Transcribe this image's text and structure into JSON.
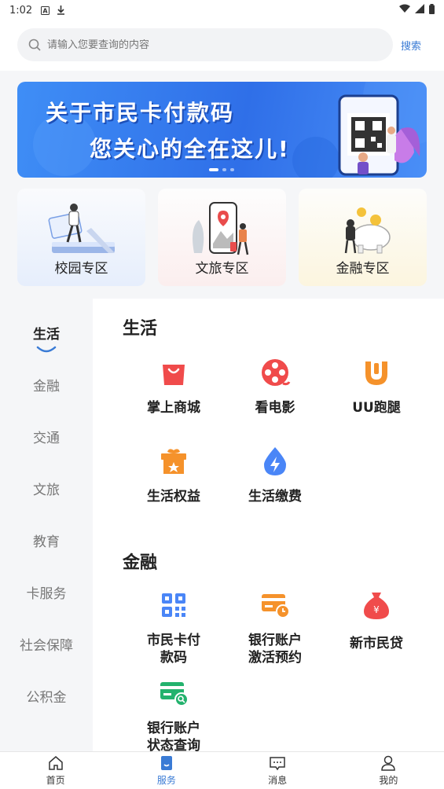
{
  "status_bar": {
    "time": "1:02"
  },
  "search": {
    "placeholder": "请输入您要查询的内容",
    "button_label": "搜索"
  },
  "banner": {
    "line1": "关于市民卡付款码",
    "line2": "您关心的全在这儿!",
    "page_count": 3,
    "active_page": 1
  },
  "zones": [
    {
      "label": "校园专区"
    },
    {
      "label": "文旅专区"
    },
    {
      "label": "金融专区"
    }
  ],
  "sidebar": {
    "items": [
      {
        "label": "生活",
        "active": true
      },
      {
        "label": "金融"
      },
      {
        "label": "交通"
      },
      {
        "label": "文旅"
      },
      {
        "label": "教育"
      },
      {
        "label": "卡服务"
      },
      {
        "label": "社会保障"
      },
      {
        "label": "公积金"
      }
    ]
  },
  "sections": {
    "life": {
      "title": "生活",
      "items": [
        {
          "label": "掌上商城",
          "icon": "shopping-bag-icon"
        },
        {
          "label": "看电影",
          "icon": "film-reel-icon"
        },
        {
          "label": "UU跑腿",
          "icon": "uu-logo-icon"
        },
        {
          "label": "生活权益",
          "icon": "gift-icon"
        },
        {
          "label": "生活缴费",
          "icon": "utility-payment-icon"
        }
      ]
    },
    "finance": {
      "title": "金融",
      "items": [
        {
          "label": "市民卡付款码",
          "icon": "qr-code-icon"
        },
        {
          "label": "银行账户激活预约",
          "icon": "bank-card-clock-icon"
        },
        {
          "label": "新市民贷",
          "icon": "money-bag-icon"
        },
        {
          "label": "银行账户状态查询",
          "icon": "bank-card-search-icon"
        }
      ]
    }
  },
  "tabbar": {
    "items": [
      {
        "label": "首页",
        "icon": "home-icon"
      },
      {
        "label": "服务",
        "icon": "service-icon",
        "active": true
      },
      {
        "label": "消息",
        "icon": "message-icon"
      },
      {
        "label": "我的",
        "icon": "profile-icon"
      }
    ]
  },
  "colors": {
    "accent": "#3a7bd5",
    "red": "#f04b4b",
    "orange": "#f5922b",
    "blue_icon": "#4a86f7",
    "green": "#23b26d"
  }
}
